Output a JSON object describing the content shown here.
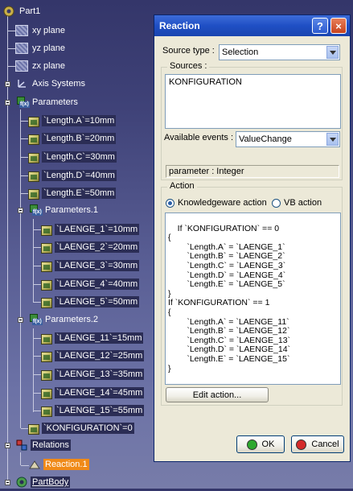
{
  "tree": {
    "part": "Part1",
    "planes": [
      "xy plane",
      "yz plane",
      "zx plane"
    ],
    "axis_systems": "Axis Systems",
    "parameters": {
      "label": "Parameters",
      "items": [
        "`Length.A`=10mm",
        "`Length.B`=20mm",
        "`Length.C`=30mm",
        "`Length.D`=40mm",
        "`Length.E`=50mm"
      ]
    },
    "parameters1": {
      "label": "Parameters.1",
      "items": [
        "`LAENGE_1`=10mm",
        "`LAENGE_2`=20mm",
        "`LAENGE_3`=30mm",
        "`LAENGE_4`=40mm",
        "`LAENGE_5`=50mm"
      ]
    },
    "parameters2": {
      "label": "Parameters.2",
      "items": [
        "`LAENGE_11`=15mm",
        "`LAENGE_12`=25mm",
        "`LAENGE_13`=35mm",
        "`LAENGE_14`=45mm",
        "`LAENGE_15`=55mm"
      ]
    },
    "konfiguration": "`KONFIGURATION`=0",
    "relations": "Relations",
    "reaction": "Reaction.1",
    "partbody": "PartBody"
  },
  "dialog": {
    "title": "Reaction",
    "help_glyph": "?",
    "close_glyph": "×",
    "source_type_label": "Source type :",
    "source_type_value": "Selection",
    "sources_label": "Sources :",
    "sources_value": "KONFIGURATION",
    "available_events_label": "Available events :",
    "available_events_value": "ValueChange",
    "parameter_status": "parameter : Integer",
    "action_label": "Action",
    "radio_knowledgeware": "Knowledgeware action",
    "radio_vb": "VB action",
    "action_code": "If `KONFIGURATION` == 0\n{\n\t\t`Length.A` = `LAENGE_1`\n\t\t`Length.B` = `LAENGE_2`\n\t\t`Length.C` = `LAENGE_3`\n\t\t`Length.D` = `LAENGE_4`\n\t\t`Length.E` = `LAENGE_5`\n}\nIf `KONFIGURATION` == 1\n{\n\t\t`Length.A` = `LAENGE_11`\n\t\t`Length.B` = `LAENGE_12`\n\t\t`Length.C` = `LAENGE_13`\n\t\t`Length.D` = `LAENGE_14`\n\t\t`Length.E` = `LAENGE_15`\n}",
    "edit_action_label": "Edit action...",
    "ok_label": "OK",
    "cancel_label": "Cancel"
  },
  "colors": {
    "ok_dot": "#2ea82e",
    "cancel_dot": "#d42a2a",
    "selection": "#f08a18"
  }
}
